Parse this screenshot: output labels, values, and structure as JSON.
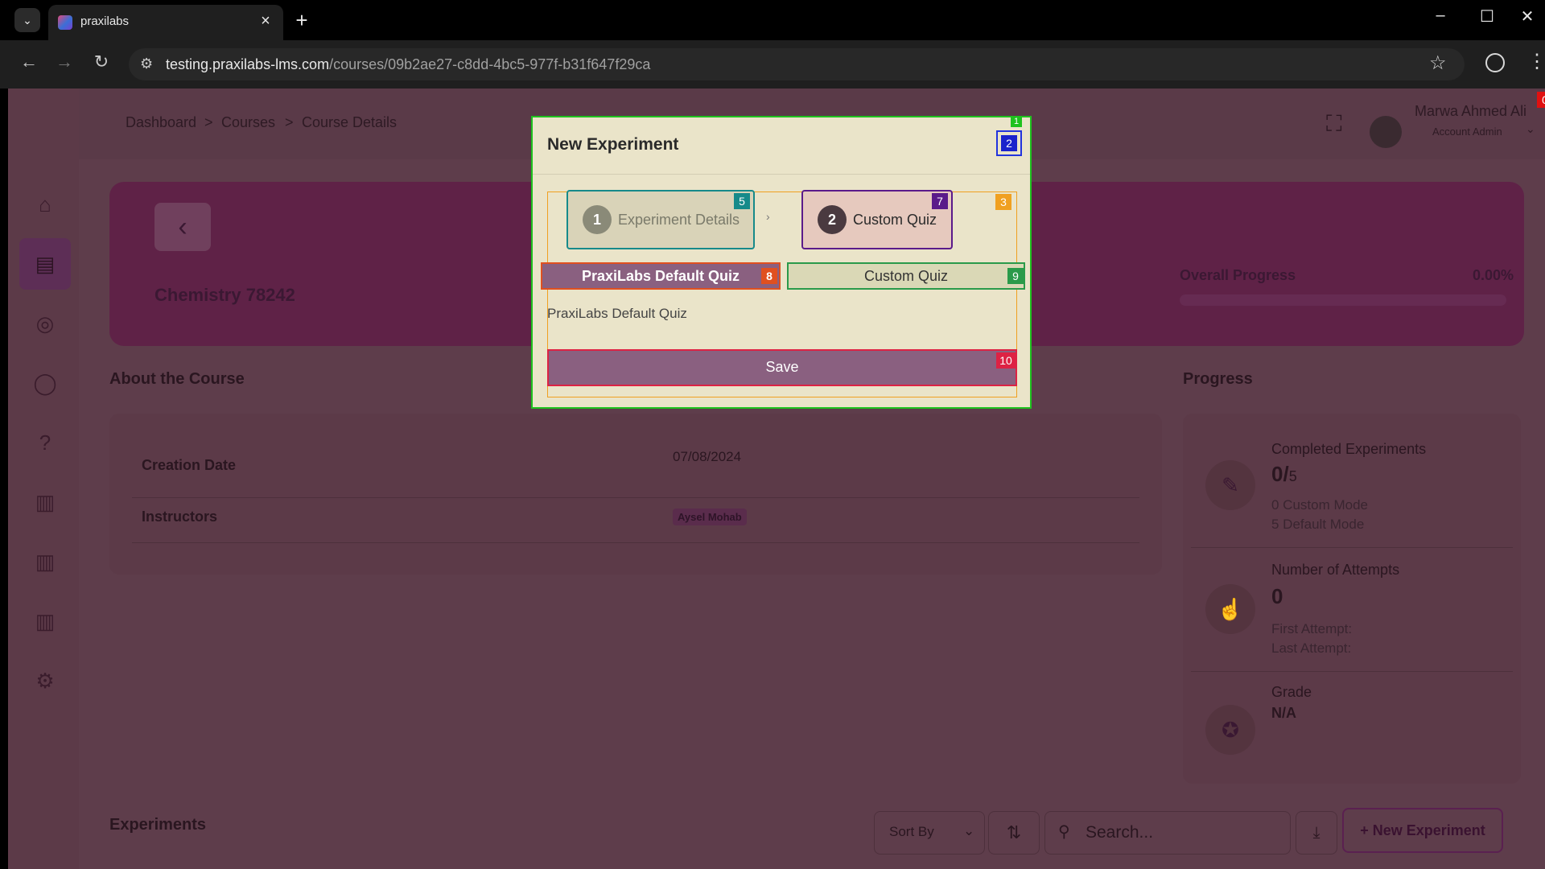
{
  "browser": {
    "tab_title": "praxilabs",
    "url_host": "testing.praxilabs-lms.com",
    "url_path": "/courses/09b2ae27-c8dd-4bc5-977f-b31f647f29ca"
  },
  "breadcrumb": {
    "items": [
      "Dashboard",
      "Courses",
      "Course Details"
    ],
    "separator": ">"
  },
  "user": {
    "name": "Marwa Ahmed Ali",
    "role": "Account Admin"
  },
  "course": {
    "name": "Chemistry 78242",
    "overall_progress_label": "Overall Progress",
    "overall_progress_value": "0.00%",
    "overall_progress_fraction": 0
  },
  "about": {
    "title": "About the Course",
    "creation_label": "Creation Date",
    "creation_value": "07/08/2024",
    "instructors_label": "Instructors",
    "instructor": "Aysel Mohab"
  },
  "progress": {
    "title": "Progress",
    "completed_label": "Completed Experiments",
    "completed_done": "0/",
    "completed_total": "5",
    "custom_mode": "0 Custom Mode",
    "default_mode": "5 Default Mode",
    "attempts_label": "Number of Attempts",
    "attempts_value": "0",
    "first_attempt": "First Attempt:",
    "last_attempt": "Last Attempt:",
    "grade_label": "Grade",
    "grade_value": "N/A"
  },
  "experiments": {
    "title": "Experiments",
    "sort_label": "Sort By",
    "search_placeholder": "Search...",
    "new_button": "+ New Experiment"
  },
  "modal": {
    "title": "New Experiment",
    "step1_num": "1",
    "step1_label": "Experiment Details",
    "step2_num": "2",
    "step2_label": "Custom Quiz",
    "tab_default": "PraxiLabs Default Quiz",
    "tab_custom": "Custom Quiz",
    "selected_quiz": "PraxiLabs Default Quiz",
    "save": "Save"
  },
  "overlay_badges": [
    "0",
    "1",
    "2",
    "3",
    "5",
    "7",
    "8",
    "9",
    "10"
  ],
  "colors": {
    "modal_bg": "#eae4c9",
    "primary": "#8a6080",
    "overlay": "#5a3946"
  }
}
